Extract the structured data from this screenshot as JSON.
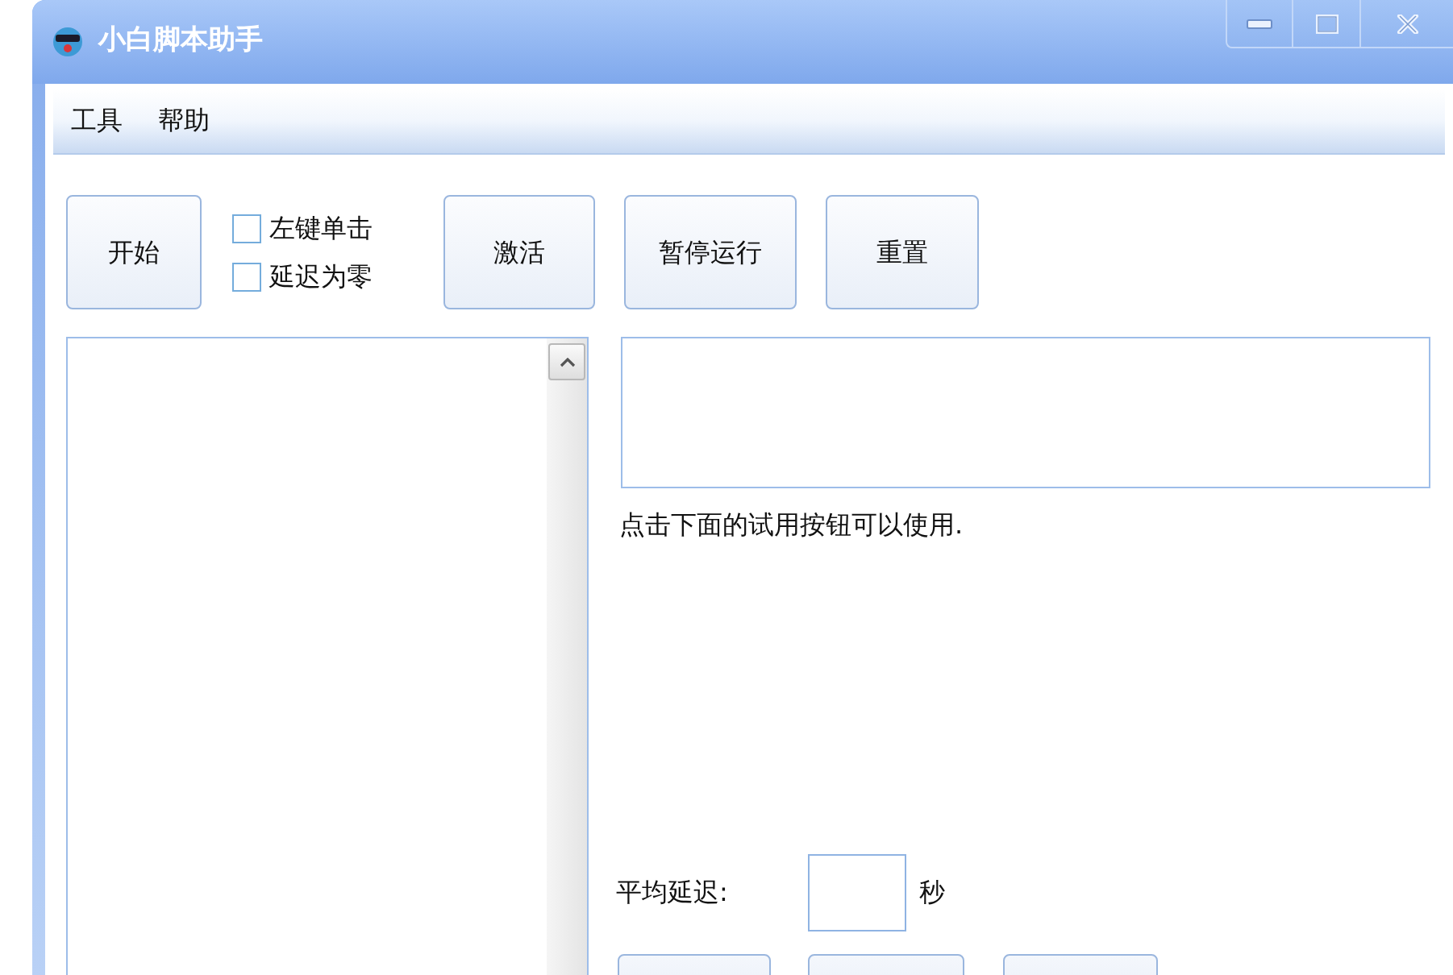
{
  "window": {
    "title": "小白脚本助手"
  },
  "menu": [
    {
      "label": "工具"
    },
    {
      "label": "帮助"
    }
  ],
  "toolbar": [
    {
      "kind": "button",
      "label": "开始"
    },
    {
      "kind": "checkboxes",
      "items": [
        {
          "label": "左键单击",
          "checked": false
        },
        {
          "label": "延迟为零",
          "checked": false
        }
      ]
    },
    {
      "kind": "button",
      "label": "激活"
    },
    {
      "kind": "button",
      "label": "暂停运行"
    },
    {
      "kind": "button",
      "label": "重置"
    }
  ],
  "hint": "点击下面的试用按钮可以使用.",
  "delay": {
    "label": "平均延迟:",
    "unit": "秒"
  }
}
